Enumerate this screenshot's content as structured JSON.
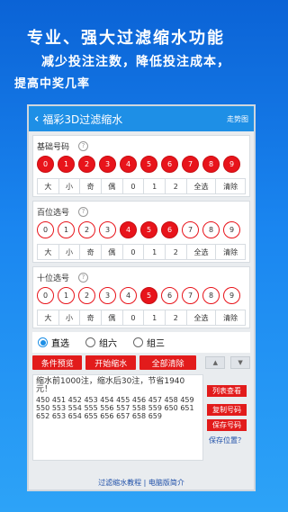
{
  "promo": {
    "line1": "专业、强大过滤缩水功能",
    "line2": "减少投注注数，降低投注成本，",
    "line3": "提高中奖几率"
  },
  "app": {
    "back_icon": "back-chevron-icon",
    "title": "福彩3D过滤缩水",
    "trend_label": "走势图"
  },
  "panels": [
    {
      "name": "基础号码",
      "balls": [
        {
          "label": "0",
          "selected": true
        },
        {
          "label": "1",
          "selected": true
        },
        {
          "label": "2",
          "selected": true
        },
        {
          "label": "3",
          "selected": true
        },
        {
          "label": "4",
          "selected": true
        },
        {
          "label": "5",
          "selected": true
        },
        {
          "label": "6",
          "selected": true
        },
        {
          "label": "7",
          "selected": true
        },
        {
          "label": "8",
          "selected": true
        },
        {
          "label": "9",
          "selected": true
        }
      ],
      "options": [
        "大",
        "小",
        "奇",
        "偶",
        "0",
        "1",
        "2",
        "全选",
        "清除"
      ]
    },
    {
      "name": "百位选号",
      "balls": [
        {
          "label": "0",
          "selected": false
        },
        {
          "label": "1",
          "selected": false
        },
        {
          "label": "2",
          "selected": false
        },
        {
          "label": "3",
          "selected": false
        },
        {
          "label": "4",
          "selected": true
        },
        {
          "label": "5",
          "selected": true
        },
        {
          "label": "6",
          "selected": true
        },
        {
          "label": "7",
          "selected": false
        },
        {
          "label": "8",
          "selected": false
        },
        {
          "label": "9",
          "selected": false
        }
      ],
      "options": [
        "大",
        "小",
        "奇",
        "偶",
        "0",
        "1",
        "2",
        "全选",
        "清除"
      ]
    },
    {
      "name": "十位选号",
      "balls": [
        {
          "label": "0",
          "selected": false
        },
        {
          "label": "1",
          "selected": false
        },
        {
          "label": "2",
          "selected": false
        },
        {
          "label": "3",
          "selected": false
        },
        {
          "label": "4",
          "selected": false
        },
        {
          "label": "5",
          "selected": true
        },
        {
          "label": "6",
          "selected": false
        },
        {
          "label": "7",
          "selected": false
        },
        {
          "label": "8",
          "selected": false
        },
        {
          "label": "9",
          "selected": false
        }
      ],
      "options": [
        "大",
        "小",
        "奇",
        "偶",
        "0",
        "1",
        "2",
        "全选",
        "清除"
      ]
    }
  ],
  "help_glyph": "?",
  "modes": [
    {
      "label": "直选",
      "selected": true
    },
    {
      "label": "组六",
      "selected": false
    },
    {
      "label": "组三",
      "selected": false
    }
  ],
  "actions": {
    "preview": "条件预览",
    "shrink": "开始缩水",
    "clear_all": "全部清除",
    "icon_up": "move-up-icon",
    "icon_down": "move-down-icon"
  },
  "result": {
    "summary": "缩水前1000注，缩水后30注，节省1940元！",
    "numbers": "450 451 452 453 454 455 456 457 458 459 550 553 554 555 556 557 558 559 650 651 652 653 654 655 656 657 658 659"
  },
  "side": {
    "list_view": "列表查看",
    "copy_numbers": "复制号码",
    "save_numbers": "保存号码",
    "save_location": "保存位置？"
  },
  "footer": {
    "tutorial": "过滤缩水教程",
    "separator": " | ",
    "pc_intro": "电脑版简介"
  }
}
